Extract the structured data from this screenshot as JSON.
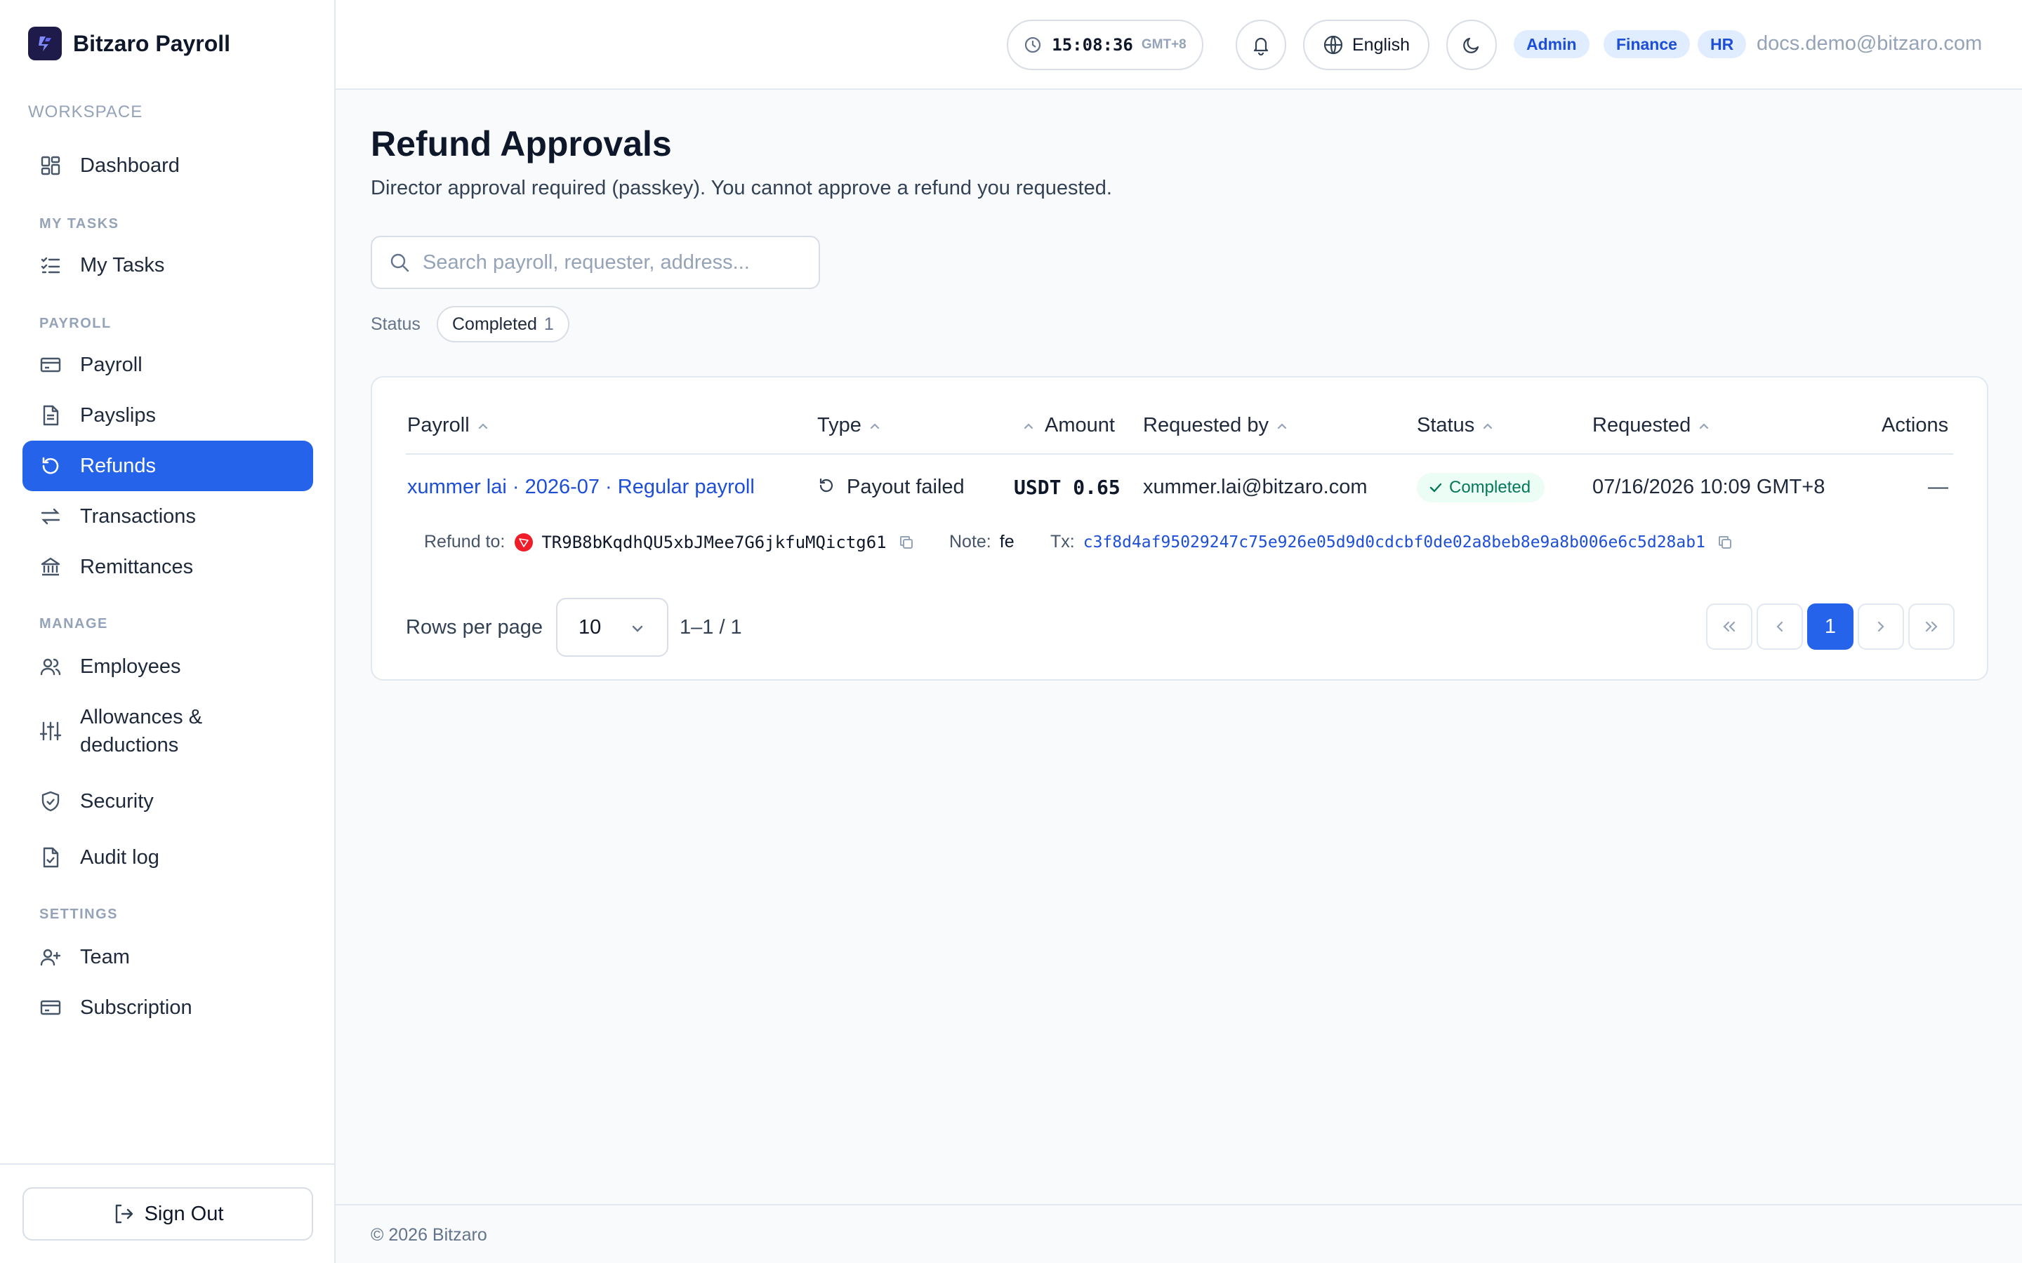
{
  "app": {
    "name": "Bitzaro Payroll"
  },
  "sidebar": {
    "workspace_label": "WORKSPACE",
    "sections": {
      "my_tasks": "MY TASKS",
      "payroll": "PAYROLL",
      "manage": "MANAGE",
      "settings": "SETTINGS"
    },
    "items": {
      "dashboard": "Dashboard",
      "my_tasks": "My Tasks",
      "payroll": "Payroll",
      "payslips": "Payslips",
      "refunds": "Refunds",
      "transactions": "Transactions",
      "remittances": "Remittances",
      "employees": "Employees",
      "allowances_line1": "Allowances &",
      "allowances_line2": "deductions",
      "security": "Security",
      "audit_log": "Audit log",
      "team": "Team",
      "subscription": "Subscription"
    },
    "active_item": "Refunds",
    "sign_out": "Sign Out"
  },
  "topbar": {
    "time": "15:08:36",
    "timezone": "GMT+8",
    "language": "English",
    "roles": [
      "Admin",
      "Finance",
      "HR"
    ],
    "user_email": "docs.demo@bitzaro.com"
  },
  "page": {
    "title": "Refund Approvals",
    "subtitle": "Director approval required (passkey). You cannot approve a refund you requested.",
    "search_placeholder": "Search payroll, requester, address...",
    "filter_label": "Status",
    "filter_chip": {
      "label": "Completed",
      "count": "1"
    }
  },
  "table": {
    "columns": {
      "payroll": "Payroll",
      "type": "Type",
      "amount": "Amount",
      "requested_by": "Requested by",
      "status": "Status",
      "requested": "Requested",
      "actions": "Actions"
    },
    "rows": [
      {
        "payroll": "xummer lai · 2026-07 · Regular payroll",
        "type": "Payout failed",
        "amount": "USDT 0.65",
        "requested_by": "xummer.lai@bitzaro.com",
        "status": "Completed",
        "requested": "07/16/2026 10:09 GMT+8",
        "actions": "—",
        "refund_to_label": "Refund to:",
        "refund_to": "TR9B8bKqdhQU5xbJMee7G6jkfuMQictg61",
        "note_label": "Note:",
        "note": "fe",
        "tx_label": "Tx:",
        "tx": "c3f8d4af95029247c75e926e05d9d0cdcbf0de02a8beb8e9a8b006e6c5d28ab1"
      }
    ]
  },
  "pagination": {
    "rows_per_page_label": "Rows per page",
    "rows_per_page": "10",
    "range": "1–1 / 1",
    "current_page": "1"
  },
  "footer": {
    "copyright": "© 2026 Bitzaro"
  },
  "colors": {
    "accent": "#2563eb",
    "link": "#1d4ed8",
    "success_bg": "#ecfdf5",
    "success_text": "#047857",
    "tron_red": "#ef1c2a"
  }
}
